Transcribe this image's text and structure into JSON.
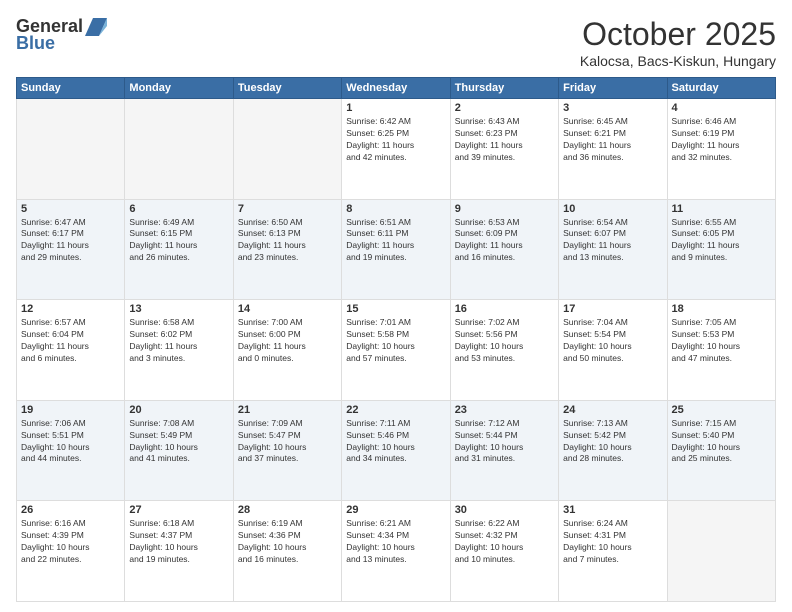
{
  "header": {
    "logo_general": "General",
    "logo_blue": "Blue",
    "month": "October 2025",
    "location": "Kalocsa, Bacs-Kiskun, Hungary"
  },
  "weekdays": [
    "Sunday",
    "Monday",
    "Tuesday",
    "Wednesday",
    "Thursday",
    "Friday",
    "Saturday"
  ],
  "weeks": [
    [
      {
        "day": "",
        "info": ""
      },
      {
        "day": "",
        "info": ""
      },
      {
        "day": "",
        "info": ""
      },
      {
        "day": "1",
        "info": "Sunrise: 6:42 AM\nSunset: 6:25 PM\nDaylight: 11 hours\nand 42 minutes."
      },
      {
        "day": "2",
        "info": "Sunrise: 6:43 AM\nSunset: 6:23 PM\nDaylight: 11 hours\nand 39 minutes."
      },
      {
        "day": "3",
        "info": "Sunrise: 6:45 AM\nSunset: 6:21 PM\nDaylight: 11 hours\nand 36 minutes."
      },
      {
        "day": "4",
        "info": "Sunrise: 6:46 AM\nSunset: 6:19 PM\nDaylight: 11 hours\nand 32 minutes."
      }
    ],
    [
      {
        "day": "5",
        "info": "Sunrise: 6:47 AM\nSunset: 6:17 PM\nDaylight: 11 hours\nand 29 minutes."
      },
      {
        "day": "6",
        "info": "Sunrise: 6:49 AM\nSunset: 6:15 PM\nDaylight: 11 hours\nand 26 minutes."
      },
      {
        "day": "7",
        "info": "Sunrise: 6:50 AM\nSunset: 6:13 PM\nDaylight: 11 hours\nand 23 minutes."
      },
      {
        "day": "8",
        "info": "Sunrise: 6:51 AM\nSunset: 6:11 PM\nDaylight: 11 hours\nand 19 minutes."
      },
      {
        "day": "9",
        "info": "Sunrise: 6:53 AM\nSunset: 6:09 PM\nDaylight: 11 hours\nand 16 minutes."
      },
      {
        "day": "10",
        "info": "Sunrise: 6:54 AM\nSunset: 6:07 PM\nDaylight: 11 hours\nand 13 minutes."
      },
      {
        "day": "11",
        "info": "Sunrise: 6:55 AM\nSunset: 6:05 PM\nDaylight: 11 hours\nand 9 minutes."
      }
    ],
    [
      {
        "day": "12",
        "info": "Sunrise: 6:57 AM\nSunset: 6:04 PM\nDaylight: 11 hours\nand 6 minutes."
      },
      {
        "day": "13",
        "info": "Sunrise: 6:58 AM\nSunset: 6:02 PM\nDaylight: 11 hours\nand 3 minutes."
      },
      {
        "day": "14",
        "info": "Sunrise: 7:00 AM\nSunset: 6:00 PM\nDaylight: 11 hours\nand 0 minutes."
      },
      {
        "day": "15",
        "info": "Sunrise: 7:01 AM\nSunset: 5:58 PM\nDaylight: 10 hours\nand 57 minutes."
      },
      {
        "day": "16",
        "info": "Sunrise: 7:02 AM\nSunset: 5:56 PM\nDaylight: 10 hours\nand 53 minutes."
      },
      {
        "day": "17",
        "info": "Sunrise: 7:04 AM\nSunset: 5:54 PM\nDaylight: 10 hours\nand 50 minutes."
      },
      {
        "day": "18",
        "info": "Sunrise: 7:05 AM\nSunset: 5:53 PM\nDaylight: 10 hours\nand 47 minutes."
      }
    ],
    [
      {
        "day": "19",
        "info": "Sunrise: 7:06 AM\nSunset: 5:51 PM\nDaylight: 10 hours\nand 44 minutes."
      },
      {
        "day": "20",
        "info": "Sunrise: 7:08 AM\nSunset: 5:49 PM\nDaylight: 10 hours\nand 41 minutes."
      },
      {
        "day": "21",
        "info": "Sunrise: 7:09 AM\nSunset: 5:47 PM\nDaylight: 10 hours\nand 37 minutes."
      },
      {
        "day": "22",
        "info": "Sunrise: 7:11 AM\nSunset: 5:46 PM\nDaylight: 10 hours\nand 34 minutes."
      },
      {
        "day": "23",
        "info": "Sunrise: 7:12 AM\nSunset: 5:44 PM\nDaylight: 10 hours\nand 31 minutes."
      },
      {
        "day": "24",
        "info": "Sunrise: 7:13 AM\nSunset: 5:42 PM\nDaylight: 10 hours\nand 28 minutes."
      },
      {
        "day": "25",
        "info": "Sunrise: 7:15 AM\nSunset: 5:40 PM\nDaylight: 10 hours\nand 25 minutes."
      }
    ],
    [
      {
        "day": "26",
        "info": "Sunrise: 6:16 AM\nSunset: 4:39 PM\nDaylight: 10 hours\nand 22 minutes."
      },
      {
        "day": "27",
        "info": "Sunrise: 6:18 AM\nSunset: 4:37 PM\nDaylight: 10 hours\nand 19 minutes."
      },
      {
        "day": "28",
        "info": "Sunrise: 6:19 AM\nSunset: 4:36 PM\nDaylight: 10 hours\nand 16 minutes."
      },
      {
        "day": "29",
        "info": "Sunrise: 6:21 AM\nSunset: 4:34 PM\nDaylight: 10 hours\nand 13 minutes."
      },
      {
        "day": "30",
        "info": "Sunrise: 6:22 AM\nSunset: 4:32 PM\nDaylight: 10 hours\nand 10 minutes."
      },
      {
        "day": "31",
        "info": "Sunrise: 6:24 AM\nSunset: 4:31 PM\nDaylight: 10 hours\nand 7 minutes."
      },
      {
        "day": "",
        "info": ""
      }
    ]
  ]
}
